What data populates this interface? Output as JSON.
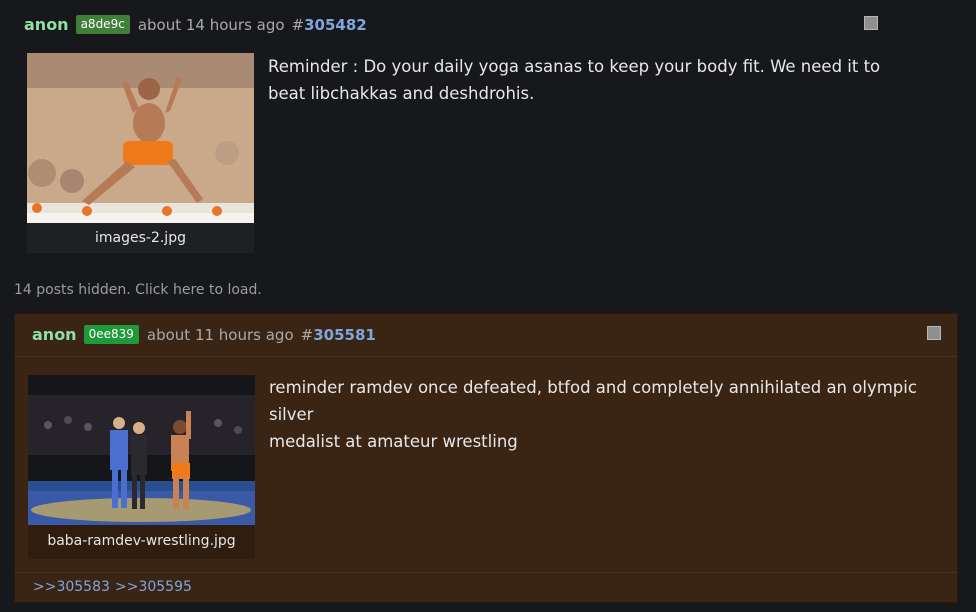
{
  "post1": {
    "name": "anon",
    "id": "a8de9c",
    "id_color": "#3f7f3a",
    "time": "about 14 hours ago",
    "hash": "#",
    "number": "305482",
    "filename": "images-2.jpg",
    "text_line1": "Reminder : Do your daily yoga asanas to keep your body fit. We need it to",
    "text_line2": "beat libchakkas and deshdrohis."
  },
  "hidden_posts": "14 posts hidden. Click here to load.",
  "post2": {
    "name": "anon",
    "id": "0ee839",
    "id_color": "#1f9a3a",
    "time": "about 11 hours ago",
    "hash": "#",
    "number": "305581",
    "filename": "baba-ramdev-wrestling.jpg",
    "text_line1": "reminder ramdev once defeated, btfod and completely annihilated an olympic silver",
    "text_line2": "medalist at amateur wrestling",
    "backlinks": [
      ">>305583",
      ">>305595"
    ]
  },
  "colors": {
    "page_bg": "#17181b",
    "highlight_post_bg": "#3a2413",
    "name": "#8fe0a4",
    "link": "#7fa6df"
  },
  "icons": [
    "checkbox-icon"
  ]
}
